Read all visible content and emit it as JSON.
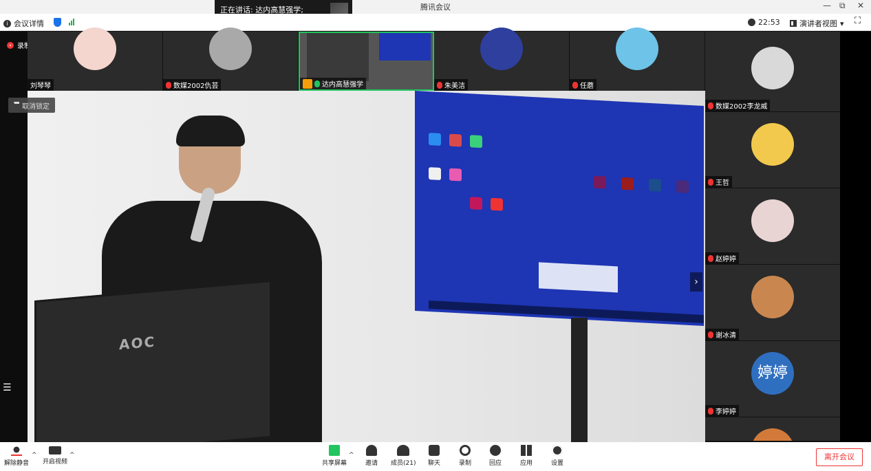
{
  "window": {
    "title": "腾讯会议",
    "minimize": "—",
    "restore": "⧉",
    "close": "✕"
  },
  "speaking": {
    "label": "正在讲话:  达内高慧强学;"
  },
  "toolbar": {
    "meeting_info": "会议详情",
    "time": "22:53",
    "view_mode": "演讲者视图",
    "view_caret": "▾",
    "fullscreen": "⛶"
  },
  "recording": {
    "label": "录制中"
  },
  "unpin": {
    "label": "取消锁定"
  },
  "thumbs": [
    {
      "name": "刘琴琴",
      "color": "#f4d6cf"
    },
    {
      "name": "数媒2002仇芸",
      "color": "#a9a9a9"
    },
    {
      "name": "达内高慧强学",
      "color": "#666"
    },
    {
      "name": "朱美洁",
      "color": "#2e3f9e"
    },
    {
      "name": "任蘑",
      "color": "#6ec3e8"
    }
  ],
  "sidebar": [
    {
      "name": "数媒2002李龙威",
      "color": "#d9d9d9"
    },
    {
      "name": "王哲",
      "color": "#f2c94c"
    },
    {
      "name": "赵婷婷",
      "color": "#e9d4d4"
    },
    {
      "name": "谢冰清",
      "color": "#c9874f"
    },
    {
      "name": "李婷婷",
      "avatar_text": "婷婷",
      "color": "#2f6fc0"
    },
    {
      "name": "",
      "color": "#d27a3a"
    }
  ],
  "main": {
    "aoc_brand": "AOC",
    "next_arrow": "›",
    "list_icon": "☰"
  },
  "bottom": {
    "unmute": "解除静音",
    "start_video": "开启视频",
    "share": "共享屏幕",
    "invite": "邀请",
    "members": "成员(21)",
    "chat": "聊天",
    "record": "录制",
    "interact": "回应",
    "apps": "应用",
    "settings": "设置",
    "leave": "离开会议",
    "caret": "^"
  },
  "colors": {
    "accent": "#22c55e",
    "danger": "#e33333",
    "shield": "#1a73e8"
  }
}
